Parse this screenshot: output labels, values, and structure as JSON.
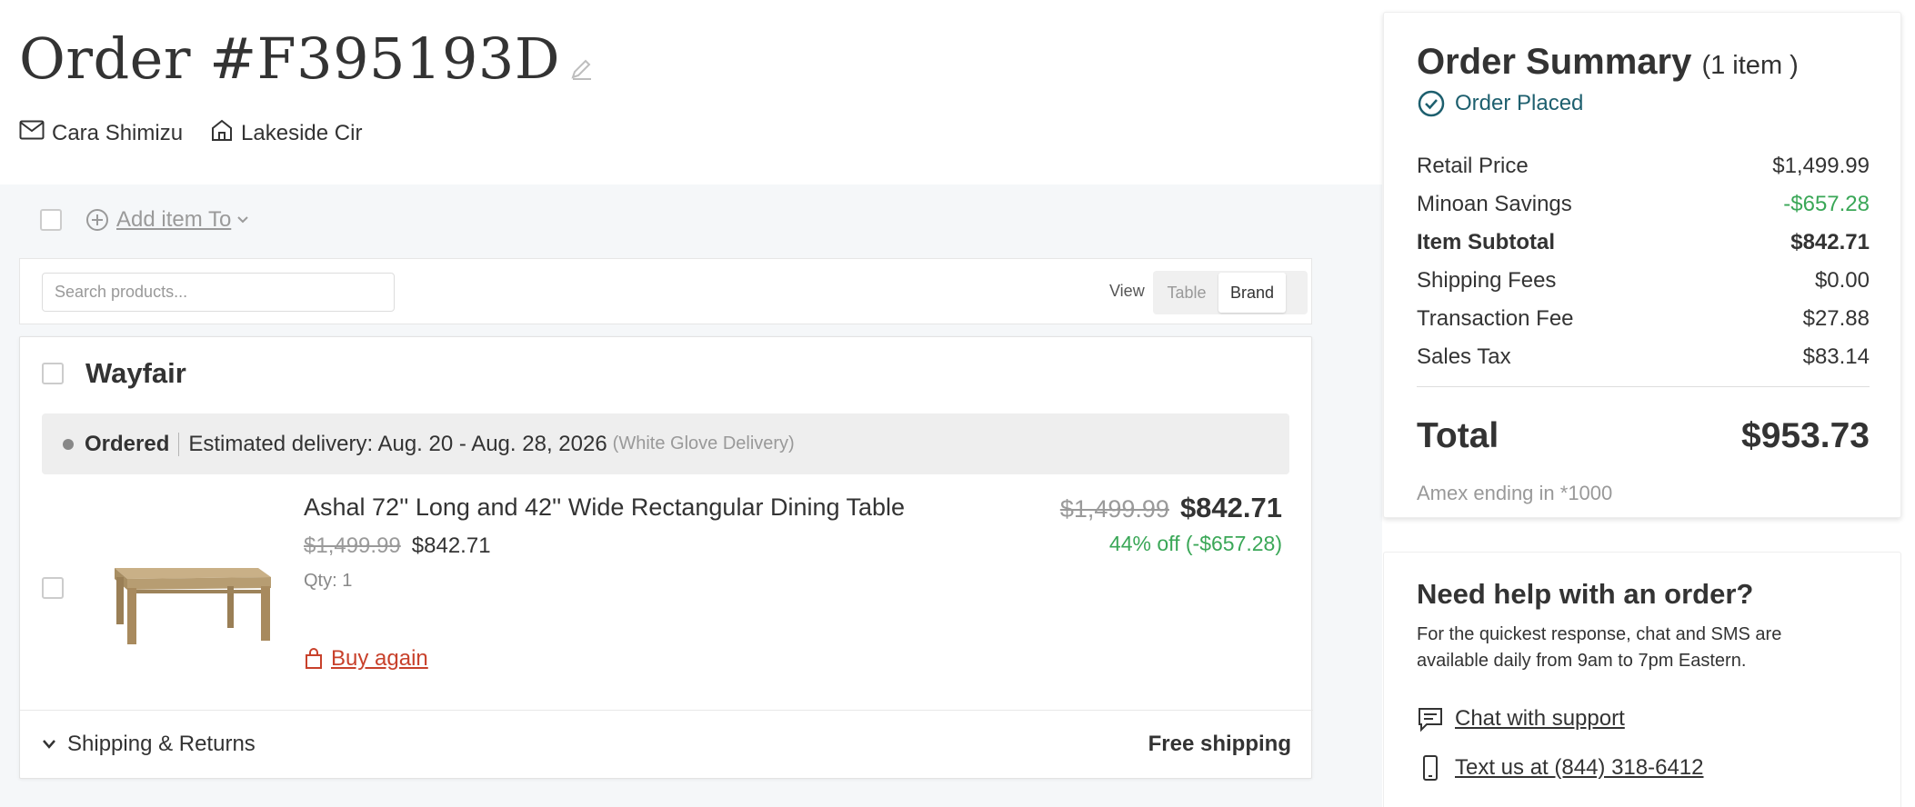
{
  "order": {
    "title": "Order #F395193D",
    "customer_name": "Cara Shimizu",
    "address": "Lakeside Cir",
    "icons": [
      "edit-icon",
      "mail-icon",
      "home-icon"
    ]
  },
  "toolbar": {
    "add_item_label": "Add item To"
  },
  "search": {
    "placeholder": "Search products...",
    "view_label": "View",
    "view_options": [
      "Table",
      "Brand"
    ],
    "selected_view": "Brand"
  },
  "brand_group": {
    "name": "Wayfair",
    "status": {
      "state": "Ordered",
      "estimated_delivery": "Estimated delivery: Aug. 20 - Aug. 28, 2026",
      "delivery_type": "(White Glove Delivery)"
    },
    "item": {
      "name": "Ashal 72'' Long and 42'' Wide Rectangular Dining Table",
      "original_price": "$1,499.99",
      "sale_price": "$842.71",
      "qty": "Qty: 1",
      "discount": "44% off (-$657.28)",
      "buy_again": "Buy again"
    },
    "shipping_label": "Shipping & Returns",
    "shipping_value": "Free shipping"
  },
  "summary": {
    "title": "Order Summary",
    "count": "(1 item )",
    "status": "Order Placed",
    "rows": [
      {
        "label": "Retail Price",
        "value": "$1,499.99"
      },
      {
        "label": "Minoan Savings",
        "value": "-$657.28"
      },
      {
        "label": "Item Subtotal",
        "value": "$842.71"
      },
      {
        "label": "Shipping Fees",
        "value": "$0.00"
      },
      {
        "label": "Transaction Fee",
        "value": "$27.88"
      },
      {
        "label": "Sales Tax",
        "value": "$83.14"
      }
    ],
    "total_label": "Total",
    "total_value": "$953.73",
    "card_note": "Amex ending in *1000"
  },
  "help": {
    "title": "Need help with an order?",
    "text": "For the quickest response, chat and SMS are available daily from 9am to 7pm Eastern.",
    "chat_label": "Chat with support",
    "text_label": "Text us at (844) 318-6412"
  },
  "colors": {
    "accent_green": "#3aa757",
    "status_teal": "#1d5f6e",
    "buy_again_red": "#c8412b",
    "page_bg": "#f5f7f9"
  }
}
